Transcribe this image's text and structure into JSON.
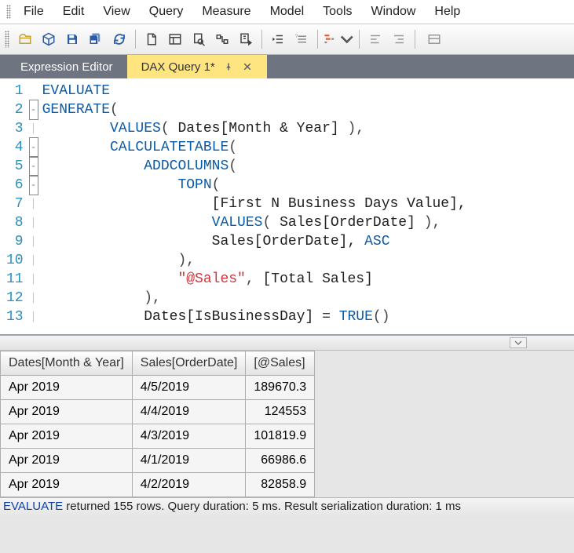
{
  "menu": [
    "File",
    "Edit",
    "View",
    "Query",
    "Measure",
    "Model",
    "Tools",
    "Window",
    "Help"
  ],
  "tabs": {
    "inactive_label": "Expression Editor",
    "active_label": "DAX Query 1*"
  },
  "code": {
    "lines": [
      {
        "n": 1,
        "tokens": [
          [
            "EVALUATE",
            "kw"
          ]
        ]
      },
      {
        "n": 2,
        "tokens": [
          [
            "GENERATE",
            "func"
          ],
          [
            "(",
            "bracket"
          ]
        ]
      },
      {
        "n": 3,
        "tokens": [
          [
            "        ",
            ""
          ],
          [
            "VALUES",
            "func"
          ],
          [
            "( ",
            "bracket"
          ],
          [
            "Dates[Month & Year]",
            "col"
          ],
          [
            " ),",
            "bracket"
          ]
        ]
      },
      {
        "n": 4,
        "tokens": [
          [
            "        ",
            ""
          ],
          [
            "CALCULATETABLE",
            "func"
          ],
          [
            "(",
            "bracket"
          ]
        ]
      },
      {
        "n": 5,
        "tokens": [
          [
            "            ",
            ""
          ],
          [
            "ADDCOLUMNS",
            "func"
          ],
          [
            "(",
            "bracket"
          ]
        ]
      },
      {
        "n": 6,
        "tokens": [
          [
            "                ",
            ""
          ],
          [
            "TOPN",
            "func"
          ],
          [
            "(",
            "bracket"
          ]
        ]
      },
      {
        "n": 7,
        "tokens": [
          [
            "                    ",
            ""
          ],
          [
            "[First N Business Days Value],",
            "col"
          ]
        ]
      },
      {
        "n": 8,
        "tokens": [
          [
            "                    ",
            ""
          ],
          [
            "VALUES",
            "func"
          ],
          [
            "( ",
            "bracket"
          ],
          [
            "Sales[OrderDate]",
            "col"
          ],
          [
            " ),",
            "bracket"
          ]
        ]
      },
      {
        "n": 9,
        "tokens": [
          [
            "                    ",
            ""
          ],
          [
            "Sales[OrderDate], ",
            "col"
          ],
          [
            "ASC",
            "kw"
          ]
        ]
      },
      {
        "n": 10,
        "tokens": [
          [
            "                ",
            ""
          ],
          [
            "),",
            "bracket"
          ]
        ]
      },
      {
        "n": 11,
        "tokens": [
          [
            "                ",
            ""
          ],
          [
            "\"@Sales\"",
            "str"
          ],
          [
            ", ",
            "bracket"
          ],
          [
            "[Total Sales]",
            "col"
          ]
        ]
      },
      {
        "n": 12,
        "tokens": [
          [
            "            ",
            ""
          ],
          [
            "),",
            "bracket"
          ]
        ]
      },
      {
        "n": 13,
        "tokens": [
          [
            "            ",
            ""
          ],
          [
            "Dates[IsBusinessDay]",
            "col"
          ],
          [
            " = ",
            "op"
          ],
          [
            "TRUE",
            "func"
          ],
          [
            "()",
            "bracket"
          ]
        ]
      }
    ]
  },
  "grid": {
    "columns": [
      "Dates[Month & Year]",
      "Sales[OrderDate]",
      "[@Sales]"
    ],
    "rows": [
      [
        "Apr 2019",
        "4/5/2019",
        "189670.3"
      ],
      [
        "Apr 2019",
        "4/4/2019",
        "124553"
      ],
      [
        "Apr 2019",
        "4/3/2019",
        "101819.9"
      ],
      [
        "Apr 2019",
        "4/1/2019",
        "66986.6"
      ],
      [
        "Apr 2019",
        "4/2/2019",
        "82858.9"
      ]
    ]
  },
  "status": {
    "keyword": "EVALUATE",
    "rest": " returned 155 rows. Query duration: 5 ms. Result serialization duration: 1 ms"
  }
}
